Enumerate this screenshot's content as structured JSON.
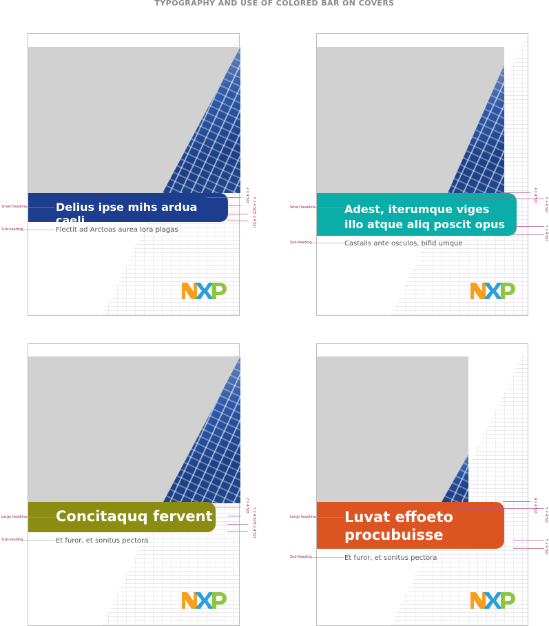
{
  "page": {
    "title": "TYPOGRAPHY AND USE OF COLORED BAR ON COVERS"
  },
  "covers": [
    {
      "headline": "Delius ipse mihs ardua caeli",
      "subheading_plain": "Flectit ad Arctoas aurea ",
      "subheading_bold": "lora plagas",
      "headline_label": "Small headline",
      "subheading_label": "Sub-heading",
      "bar_color": "#1d3e8e",
      "specs": [
        "2 x 4.5pt",
        "5 x 4.5pt",
        "5 x 4.5pt"
      ]
    },
    {
      "headline_line1": "Adest, iterumque viges",
      "headline_line2": "illo atque aliq poscit opus",
      "subheading": "Castalis ante osculos, bifid umque",
      "headline_label": "Small headline",
      "subheading_label": "Sub-heading",
      "bar_color": "#0aada8",
      "specs": [
        "4 x 4.5pt",
        "5 x 4.5pt",
        "5 x 4.5pt"
      ]
    },
    {
      "headline": "Concitaquq fervent",
      "subheading": "Et furor, et sonitus pectora",
      "headline_label": "Large headline",
      "subheading_label": "Sub-heading",
      "bar_color": "#8b8d12",
      "specs": [
        "2 x 4.5pt",
        "5 x 4.5pt",
        "5 x 4.5pt"
      ]
    },
    {
      "headline_line1": "Luvat effoeto",
      "headline_line2": "procubuisse",
      "subheading": "Et furor, et sonitus pectora",
      "headline_label": "Large headline",
      "subheading_label": "Sub-heading",
      "bar_color": "#dd5423",
      "specs": [
        "4 x 4.5pt",
        "5 x 4.5pt",
        "5 x 4.5pt"
      ]
    }
  ],
  "logo": {
    "text": "NXP",
    "colors": [
      "#f5a01c",
      "#2b9fd9",
      "#8cc63f"
    ]
  }
}
